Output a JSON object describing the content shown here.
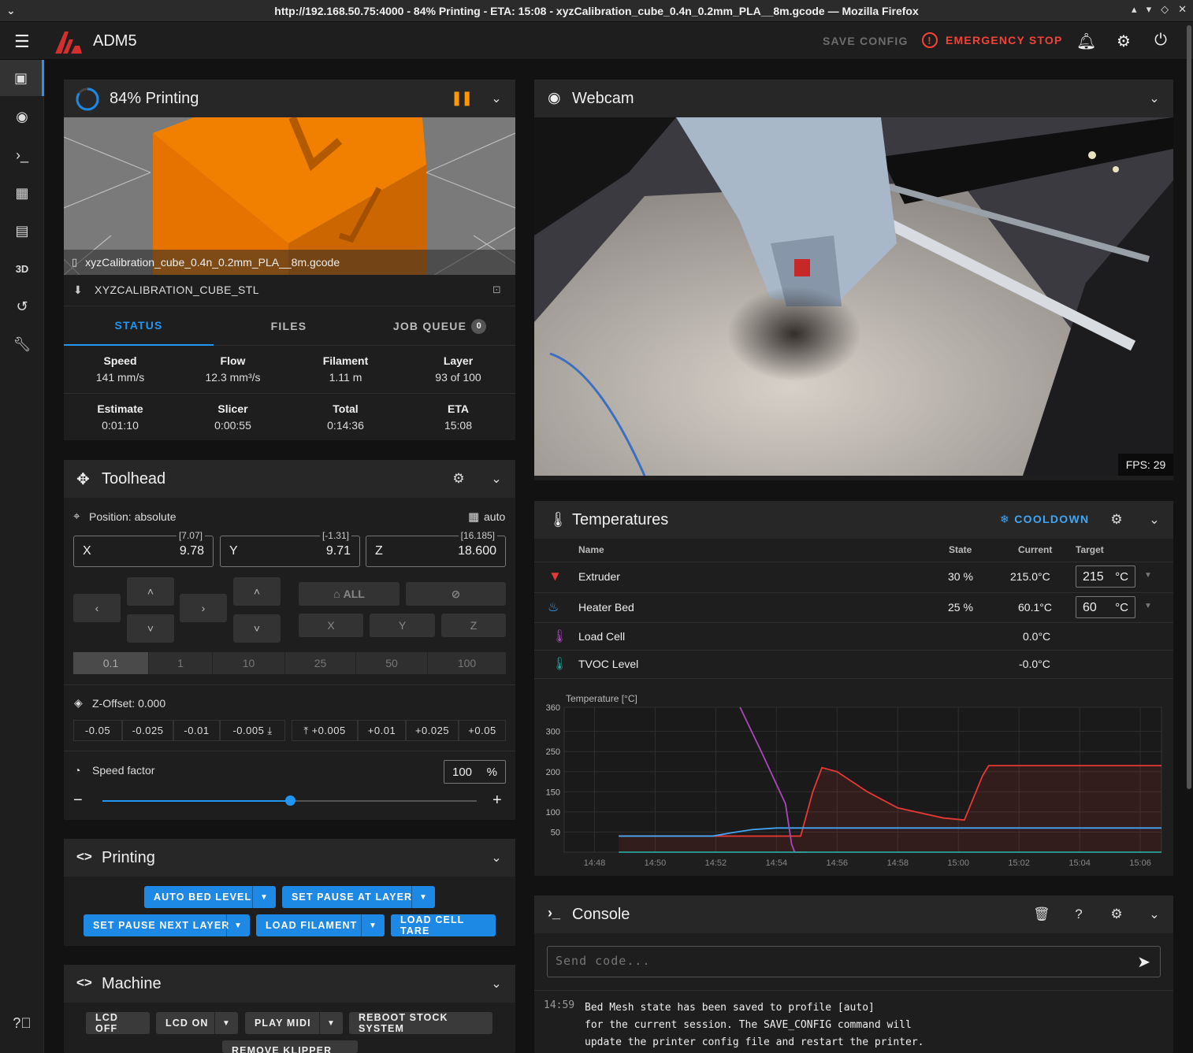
{
  "window": {
    "title": "http://192.168.50.75:4000 - 84% Printing - ETA: 15:08 - xyzCalibration_cube_0.4n_0.2mm_PLA__8m.gcode — Mozilla Firefox"
  },
  "appbar": {
    "name": "ADM5",
    "save_config": "SAVE CONFIG",
    "emergency_stop": "EMERGENCY STOP"
  },
  "status_panel": {
    "title": "84% Printing",
    "progress_percent": 84,
    "filename": "xyzCalibration_cube_0.4n_0.2mm_PLA__8m.gcode",
    "object": "XYZCALIBRATION_CUBE_STL",
    "tabs": {
      "status": "STATUS",
      "files": "FILES",
      "job_queue": "JOB QUEUE",
      "job_queue_count": "0"
    },
    "stats": [
      {
        "label": "Speed",
        "value": "141 mm/s"
      },
      {
        "label": "Flow",
        "value": "12.3 mm³/s"
      },
      {
        "label": "Filament",
        "value": "1.11 m"
      },
      {
        "label": "Layer",
        "value": "93 of 100"
      },
      {
        "label": "Estimate",
        "value": "0:01:10"
      },
      {
        "label": "Slicer",
        "value": "0:00:55"
      },
      {
        "label": "Total",
        "value": "0:14:36"
      },
      {
        "label": "ETA",
        "value": "15:08"
      }
    ]
  },
  "toolhead": {
    "title": "Toolhead",
    "position_mode": "Position: absolute",
    "auto_label": "auto",
    "x": {
      "axis": "X",
      "value": "9.78",
      "commanded": "[7.07]"
    },
    "y": {
      "axis": "Y",
      "value": "9.71",
      "commanded": "[-1.31]"
    },
    "z": {
      "axis": "Z",
      "value": "18.600",
      "commanded": "[16.185]"
    },
    "home_all": "ALL",
    "home_x": "X",
    "home_y": "Y",
    "home_z": "Z",
    "steps": [
      "0.1",
      "1",
      "10",
      "25",
      "50",
      "100"
    ],
    "zoffset_label": "Z-Offset: 0.000",
    "zoffset_down": [
      "-0.05",
      "-0.025",
      "-0.01",
      "-0.005"
    ],
    "zoffset_up": [
      "+0.005",
      "+0.01",
      "+0.025",
      "+0.05"
    ],
    "speed_factor_label": "Speed factor",
    "speed_factor_value": "100",
    "speed_factor_unit": "%",
    "speed_slider_fraction": 0.5
  },
  "printing_panel": {
    "title": "Printing",
    "buttons": [
      "AUTO BED LEVEL",
      "SET PAUSE AT LAYER",
      "SET PAUSE NEXT LAYER",
      "LOAD FILAMENT",
      "LOAD CELL TARE"
    ]
  },
  "machine_panel": {
    "title": "Machine",
    "buttons": [
      "LCD OFF",
      "LCD ON",
      "PLAY MIDI",
      "REBOOT STOCK SYSTEM",
      "REMOVE KLIPPER MOD"
    ]
  },
  "webcam": {
    "title": "Webcam",
    "fps": "FPS: 29"
  },
  "temperatures": {
    "title": "Temperatures",
    "cooldown": "COOLDOWN",
    "headers": {
      "name": "Name",
      "state": "State",
      "current": "Current",
      "target": "Target"
    },
    "rows": [
      {
        "name": "Extruder",
        "state": "30 %",
        "current": "215.0°C",
        "target": "215",
        "unit": "°C",
        "color": "#e53935"
      },
      {
        "name": "Heater Bed",
        "state": "25 %",
        "current": "60.1°C",
        "target": "60",
        "unit": "°C",
        "color": "#42a5f5"
      },
      {
        "name": "Load Cell",
        "state": "",
        "current": "0.0°C",
        "target": "",
        "unit": "",
        "color": "#ab47bc"
      },
      {
        "name": "TVOC Level",
        "state": "",
        "current": "-0.0°C",
        "target": "",
        "unit": "",
        "color": "#26a69a"
      }
    ]
  },
  "chart_data": {
    "type": "line",
    "ylabel": "Temperature [°C]",
    "ylim": [
      0,
      360
    ],
    "yticks": [
      "360",
      "300",
      "250",
      "200",
      "150",
      "100",
      "50"
    ],
    "xticks": [
      "14:48",
      "14:50",
      "14:52",
      "14:54",
      "14:56",
      "14:58",
      "15:00",
      "15:02",
      "15:04",
      "15:06"
    ],
    "xlim_minutes": [
      0,
      19.7
    ],
    "series": [
      {
        "name": "Extruder",
        "color": "#e53935",
        "x": [
          1.8,
          6.6,
          7.3,
          7.8,
          8.2,
          8.5,
          9.0,
          10.0,
          11.0,
          12.5,
          13.2,
          13.8,
          14.0,
          16,
          19.7
        ],
        "y": [
          40,
          40,
          40,
          40,
          150,
          210,
          200,
          150,
          110,
          85,
          80,
          190,
          215,
          215,
          215
        ]
      },
      {
        "name": "Heater Bed",
        "color": "#42a5f5",
        "x": [
          1.8,
          4.9,
          5.5,
          6.2,
          7.0,
          8.0,
          10,
          13,
          16,
          19.7
        ],
        "y": [
          40,
          40,
          48,
          56,
          60,
          60,
          60,
          60,
          60,
          60
        ]
      },
      {
        "name": "Load Cell",
        "color": "#ab47bc",
        "x": [
          5.8,
          6.5,
          7.3,
          7.5,
          7.6,
          7.7,
          8.0
        ],
        "y": [
          360,
          250,
          120,
          20,
          0,
          0,
          0
        ]
      },
      {
        "name": "TVOC Level",
        "color": "#26a69a",
        "x": [
          1.8,
          19.7
        ],
        "y": [
          0,
          0
        ]
      }
    ]
  },
  "console": {
    "title": "Console",
    "placeholder": "Send code...",
    "entries": [
      {
        "time": "14:59",
        "lines": [
          "Bed Mesh state has been saved to profile [auto]",
          "for the current session. The SAVE_CONFIG command will",
          "update the printer config file and restart the printer."
        ]
      }
    ]
  }
}
